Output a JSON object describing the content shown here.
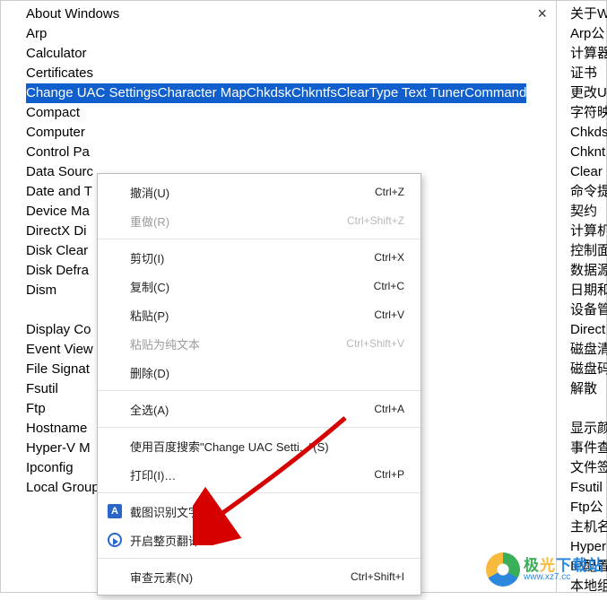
{
  "close_label": "×",
  "left_items": [
    {
      "text": "About Windows",
      "sel": false
    },
    {
      "text": "Arp",
      "sel": false
    },
    {
      "text": "Calculator",
      "sel": false
    },
    {
      "text": "Certificates",
      "sel": false
    },
    {
      "text": "Change UAC Settings",
      "sel": true
    },
    {
      "text": "Character Map",
      "sel": true
    },
    {
      "text": "Chkdsk",
      "sel": true
    },
    {
      "text": "Chkntfs",
      "sel": true
    },
    {
      "text": "ClearType Text Tuner",
      "sel": true
    },
    {
      "text": "Command",
      "sel": true
    },
    {
      "text": "Compact",
      "sel": false
    },
    {
      "text": "Computer",
      "sel": false
    },
    {
      "text": "Control Pa",
      "sel": false
    },
    {
      "text": "Data Sourc",
      "sel": false
    },
    {
      "text": "Date and T",
      "sel": false
    },
    {
      "text": "Device Ma",
      "sel": false
    },
    {
      "text": "DirectX Di",
      "sel": false
    },
    {
      "text": "Disk Clear",
      "sel": false
    },
    {
      "text": "Disk Defra",
      "sel": false
    },
    {
      "text": "Dism",
      "sel": false
    },
    {
      "text": "",
      "sel": false
    },
    {
      "text": "Display Co",
      "sel": false
    },
    {
      "text": "Event View",
      "sel": false
    },
    {
      "text": "File Signat",
      "sel": false
    },
    {
      "text": "Fsutil",
      "sel": false
    },
    {
      "text": "Ftp",
      "sel": false
    },
    {
      "text": "Hostname",
      "sel": false
    },
    {
      "text": "Hyper-V M",
      "sel": false
    },
    {
      "text": "Ipconfig",
      "sel": false
    },
    {
      "text": "Local Group Policy Editor",
      "sel": false
    }
  ],
  "right_items": [
    "关于W",
    "Arp公",
    "计算器",
    "证书",
    "更改U",
    "字符映",
    "Chkds",
    "Chknt",
    "Clear",
    "命令提",
    "契约",
    "计算机",
    "控制面",
    "数据源",
    "日期和",
    "设备管",
    "Direct",
    "磁盘清",
    "磁盘码",
    "解散",
    "",
    "显示颜",
    "事件查",
    "文件签",
    "Fsutil",
    "Ftp公",
    "主机名",
    "Hyper",
    "IP配置",
    "本地组"
  ],
  "menu": {
    "undo": {
      "label": "撤消(U)",
      "shortcut": "Ctrl+Z"
    },
    "redo": {
      "label": "重做(R)",
      "shortcut": "Ctrl+Shift+Z"
    },
    "cut": {
      "label": "剪切(I)",
      "shortcut": "Ctrl+X"
    },
    "copy": {
      "label": "复制(C)",
      "shortcut": "Ctrl+C"
    },
    "paste": {
      "label": "粘贴(P)",
      "shortcut": "Ctrl+V"
    },
    "paste_plain": {
      "label": "粘贴为纯文本",
      "shortcut": "Ctrl+Shift+V"
    },
    "delete": {
      "label": "删除(D)",
      "shortcut": ""
    },
    "select_all": {
      "label": "全选(A)",
      "shortcut": "Ctrl+A"
    },
    "baidu_search": {
      "label": "使用百度搜索\"Change UAC Setti...\"(S)",
      "shortcut": ""
    },
    "print": {
      "label": "打印(I)…",
      "shortcut": "Ctrl+P"
    },
    "ocr": {
      "label": "截图识别文字",
      "shortcut": ""
    },
    "translate": {
      "label": "开启整页翻译",
      "shortcut": ""
    },
    "inspect": {
      "label": "审查元素(N)",
      "shortcut": "Ctrl+Shift+I"
    }
  },
  "icon_capture_glyph": "A",
  "watermark": {
    "top": "极光下载站",
    "url": "www.xz7.cc"
  }
}
